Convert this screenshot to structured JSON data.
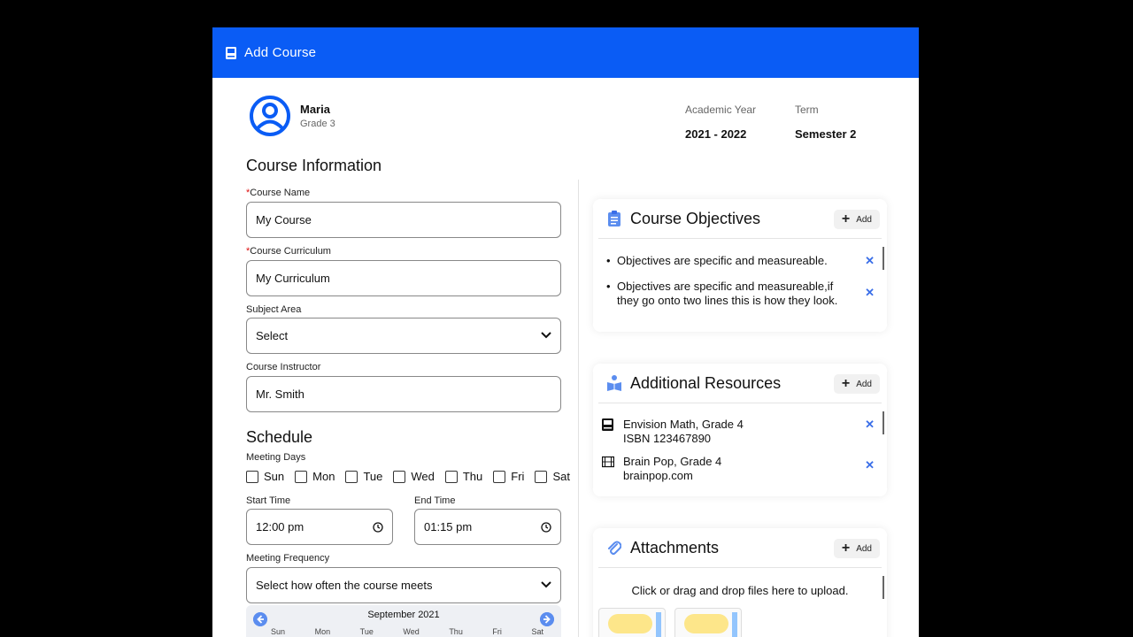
{
  "window": {
    "title": "Add Course"
  },
  "user": {
    "name": "Maria",
    "grade": "Grade 3"
  },
  "meta": {
    "academic_year_label": "Academic Year",
    "academic_year_value": "2021 - 2022",
    "term_label": "Term",
    "term_value": "Semester 2"
  },
  "course_info": {
    "heading": "Course Information",
    "course_name_label": "Course Name",
    "course_name_value": "My Course",
    "curriculum_label": "Course Curriculum",
    "curriculum_value": "My Curriculum",
    "subject_label": "Subject Area",
    "subject_value": "Select",
    "instructor_label": "Course Instructor",
    "instructor_value": "Mr. Smith",
    "required_mark": "*"
  },
  "schedule": {
    "heading": "Schedule",
    "meeting_days_label": "Meeting Days",
    "days": [
      "Sun",
      "Mon",
      "Tue",
      "Wed",
      "Thu",
      "Fri",
      "Sat"
    ],
    "start_label": "Start Time",
    "start_value": "12:00 pm",
    "end_label": "End Time",
    "end_value": "01:15 pm",
    "frequency_label": "Meeting Frequency",
    "frequency_value": "Select how often the course meets",
    "calendar_month": "September 2021",
    "weekdays": [
      "Sun",
      "Mon",
      "Tue",
      "Wed",
      "Thu",
      "Fri",
      "Sat"
    ]
  },
  "objectives": {
    "title": "Course Objectives",
    "add_label": "Add",
    "items": [
      [
        "Objectives are specific and measureable."
      ],
      [
        "Objectives are specific and measureable,if",
        "they go onto two lines this is how they look."
      ]
    ]
  },
  "resources": {
    "title": "Additional Resources",
    "add_label": "Add",
    "items": [
      {
        "icon": "book-icon",
        "line1": "Envision Math, Grade 4",
        "line2": "ISBN 123467890"
      },
      {
        "icon": "film-icon",
        "line1": "Brain Pop, Grade 4",
        "line2": "brainpop.com"
      }
    ]
  },
  "attachments": {
    "title": "Attachments",
    "add_label": "Add",
    "upload_text": "Click or drag and drop files here to upload."
  },
  "colors": {
    "accent": "#0a5cf5",
    "remove": "#3a6ee8"
  }
}
